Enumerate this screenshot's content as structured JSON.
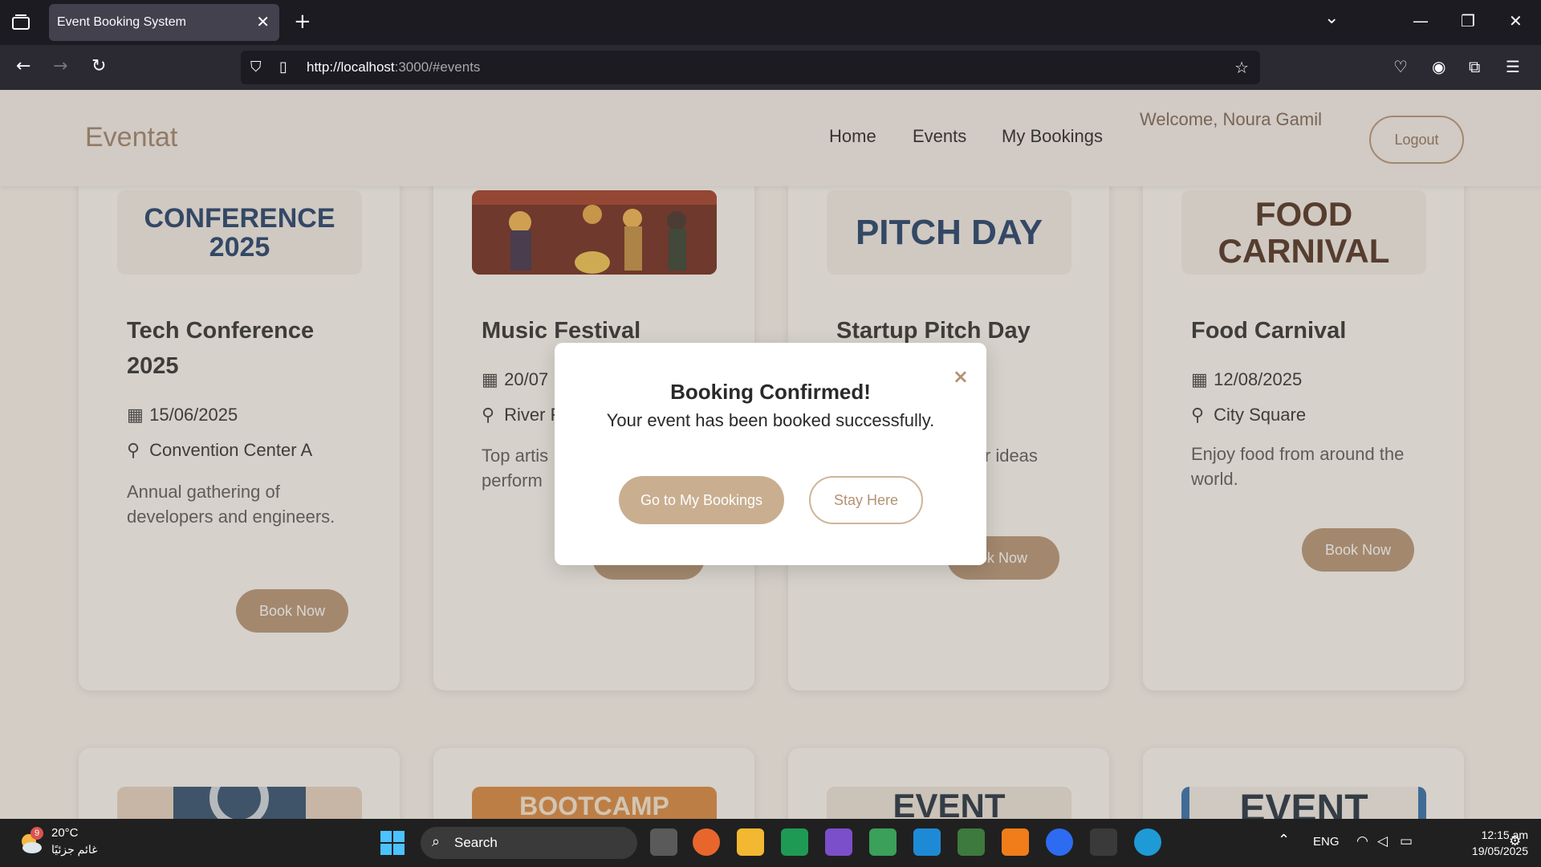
{
  "browser": {
    "tab_title": "Event Booking System",
    "url_host": "http://localhost",
    "url_rest": ":3000/#events"
  },
  "site": {
    "brand": "Eventat",
    "nav": [
      "Home",
      "Events",
      "My Bookings"
    ],
    "welcome": "Welcome, Noura Gamil",
    "logout": "Logout"
  },
  "events": [
    {
      "image_text": "CONFERENCE 2025",
      "title": "Tech Conference 2025",
      "date": "15/06/2025",
      "location": "Convention Center A",
      "description": "Annual gathering of developers and engineers.",
      "button": "Book Now"
    },
    {
      "image_text": "",
      "title": "Music Festival",
      "date": "20/07",
      "location": "River F",
      "description": "Top artis perform",
      "button": "Book Now"
    },
    {
      "image_text": "PITCH DAY",
      "title": "Startup Pitch Day",
      "date": "",
      "location": "",
      "description": "ir ideas",
      "button": "ok Now"
    },
    {
      "image_text": "FOOD CARNIVAL",
      "title": "Food Carnival",
      "date": "12/08/2025",
      "location": "City Square",
      "description": "Enjoy food from around the world.",
      "button": "Book Now"
    }
  ],
  "row2_images": [
    "",
    "BOOTCAMP",
    "EVENT",
    "EVENT"
  ],
  "modal": {
    "title": "Booking Confirmed!",
    "message": "Your event has been booked successfully.",
    "primary": "Go to My Bookings",
    "secondary": "Stay Here",
    "close": "×"
  },
  "taskbar": {
    "weather_temp": "20°C",
    "weather_desc": "غائم جزئيًا",
    "weather_badge": "9",
    "search": "Search",
    "lang": "ENG",
    "time": "12:15 am",
    "date": "19/05/2025"
  },
  "colors": {
    "accent": "#b49272",
    "accent_light": "#c9ae90"
  }
}
